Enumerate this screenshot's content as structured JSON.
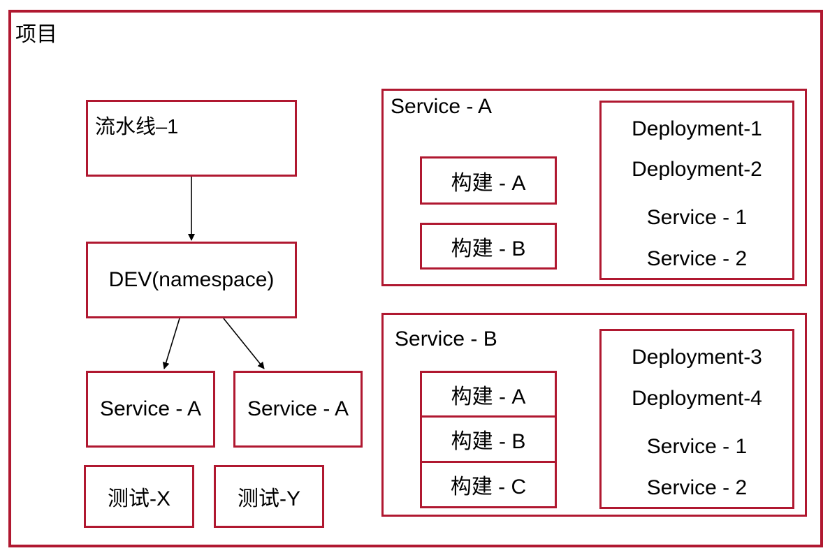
{
  "project": {
    "label": "项目"
  },
  "pipeline": {
    "name": "流水线–1",
    "namespace": "DEV(namespace)",
    "services": [
      "Service - A",
      "Service - A"
    ],
    "tests": [
      "测试-X",
      "测试-Y"
    ]
  },
  "service_groups": [
    {
      "title": "Service - A",
      "builds": [
        "构建 - A",
        "构建 - B"
      ],
      "resources": [
        "Deployment-1",
        "Deployment-2",
        "Service - 1",
        "Service - 2"
      ]
    },
    {
      "title": "Service - B",
      "builds": [
        "构建 - A",
        "构建 - B",
        "构建 - C"
      ],
      "resources": [
        "Deployment-3",
        "Deployment-4",
        "Service - 1",
        "Service - 2"
      ]
    }
  ],
  "colors": {
    "border": "#b01830"
  }
}
